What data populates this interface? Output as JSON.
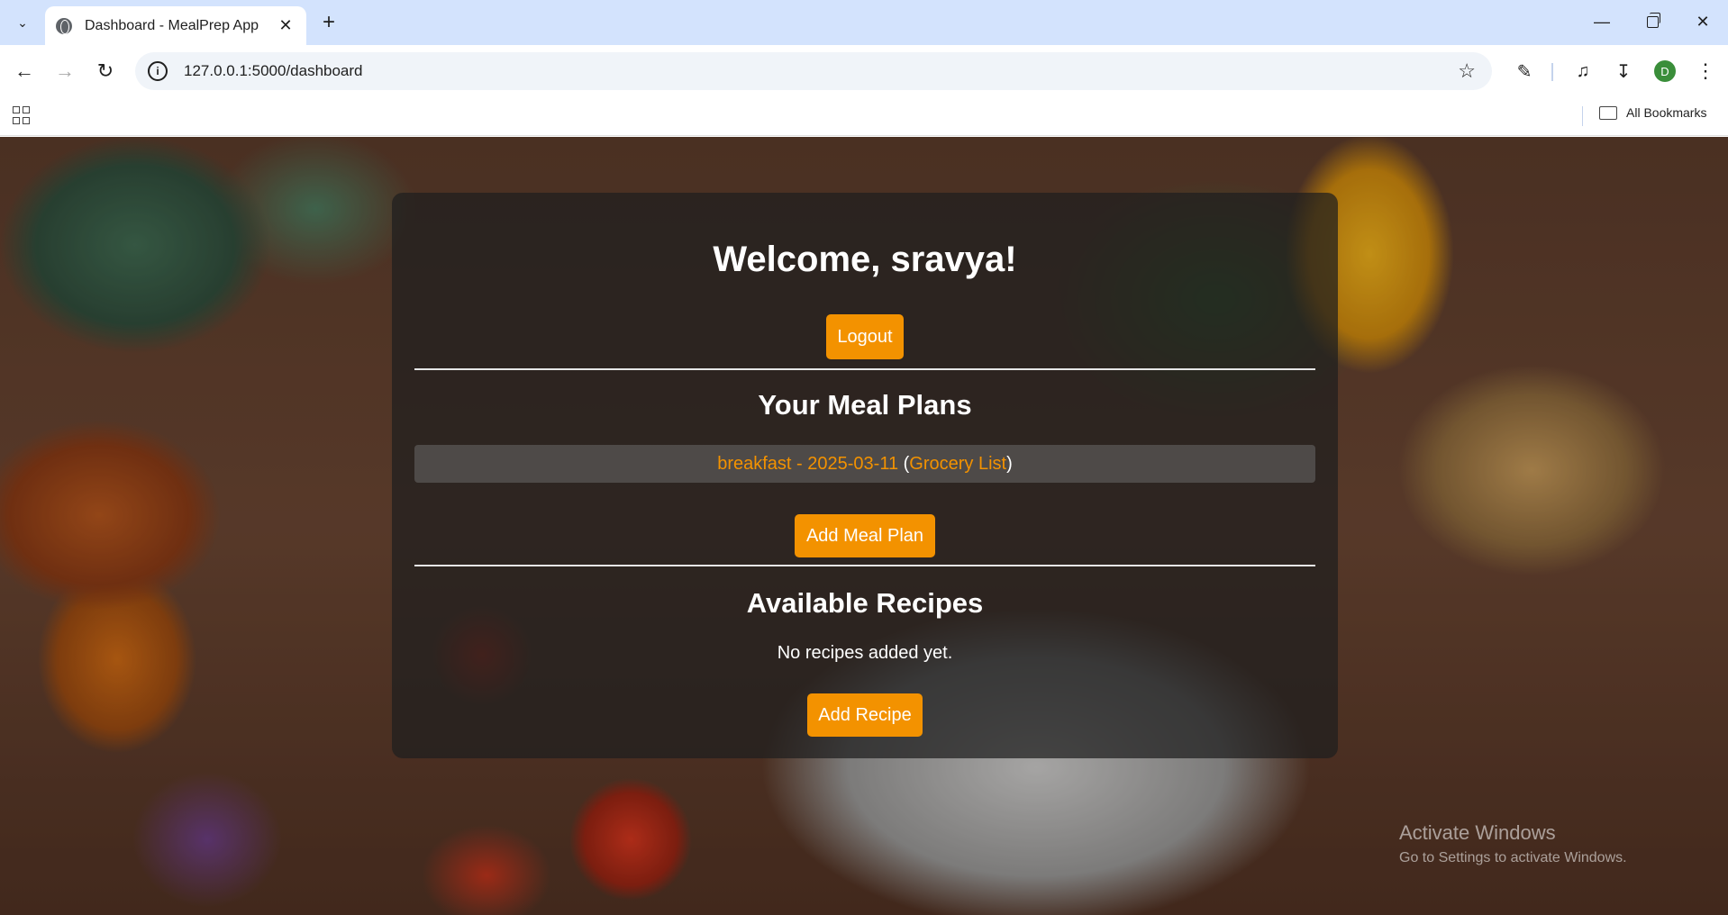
{
  "browser": {
    "tab_title": "Dashboard - MealPrep App",
    "url": "127.0.0.1:5000/dashboard",
    "all_bookmarks_label": "All Bookmarks",
    "profile_initial": "D",
    "accent_color": "#d3e3fd"
  },
  "dashboard": {
    "welcome": "Welcome, sravya!",
    "logout_label": "Logout",
    "meal_plans_heading": "Your Meal Plans",
    "meal_plans": [
      {
        "label": "breakfast - 2025-03-11",
        "grocery_link": "Grocery List"
      }
    ],
    "add_meal_plan_label": "Add Meal Plan",
    "recipes_heading": "Available Recipes",
    "no_recipes_text": "No recipes added yet.",
    "add_recipe_label": "Add Recipe",
    "button_color": "#f39200"
  },
  "watermark": {
    "title": "Activate Windows",
    "subtitle": "Go to Settings to activate Windows."
  }
}
